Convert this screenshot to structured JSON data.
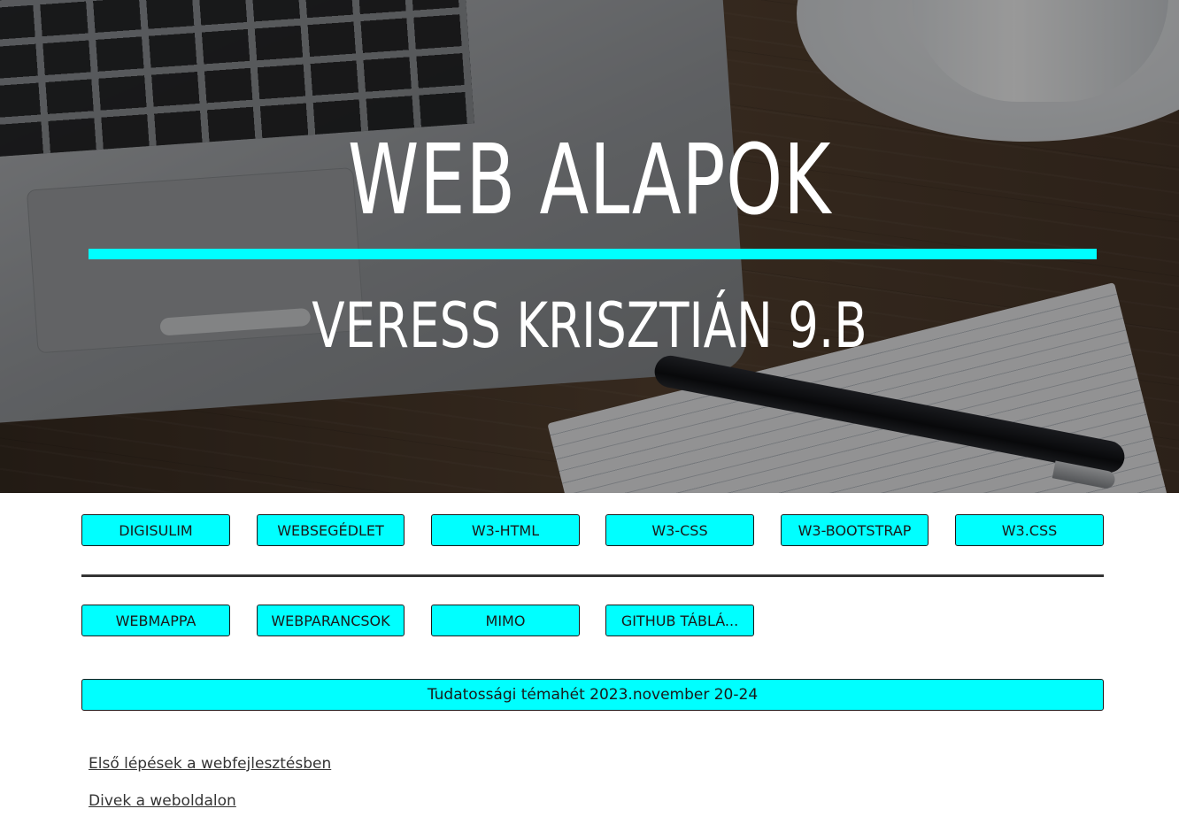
{
  "hero": {
    "title": "WEB ALAPOK",
    "subtitle": "VERESS KRISZTIÁN 9.B",
    "rule_color": "#00ffff"
  },
  "nav": {
    "row1": [
      {
        "label": "Digisulim"
      },
      {
        "label": "Websegédlet"
      },
      {
        "label": "W3-HTML"
      },
      {
        "label": "W3-CSS"
      },
      {
        "label": "W3-Bootstrap"
      },
      {
        "label": "W3.CSS"
      }
    ],
    "row2": [
      {
        "label": "Webmappa"
      },
      {
        "label": "Webparancsok"
      },
      {
        "label": "Mimo"
      },
      {
        "label": "GitHub Táblá..."
      }
    ],
    "button_color": "#00ffff"
  },
  "banner": {
    "label": "Tudatossági témahét 2023.november 20-24"
  },
  "links": [
    {
      "label": "Első lépések a webfejlesztésben"
    },
    {
      "label": "Divek a weboldalon"
    }
  ]
}
